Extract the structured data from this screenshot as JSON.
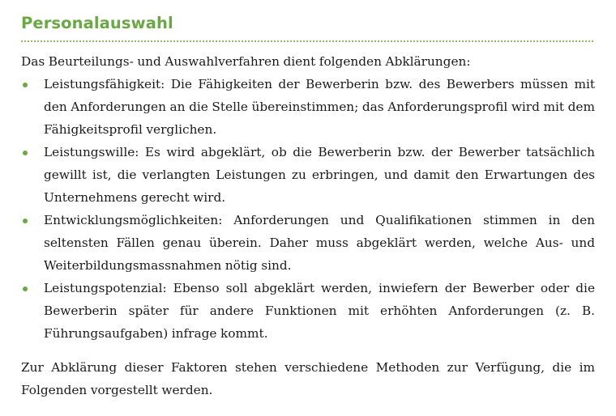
{
  "section": {
    "title": "Personalauswahl",
    "accent_color": "#6aa844"
  },
  "intro": "Das Beurteilungs- und Auswahlverfahren dient folgenden Abklärungen:",
  "items": [
    {
      "text": "Leistungsfähigkeit: Die Fähigkeiten der Bewerberin bzw. des Bewerbers müssen mit den Anforderungen an die Stelle übereinstimmen; das Anforderungsprofil wird mit dem Fähigkeitsprofil verglichen."
    },
    {
      "text": "Leistungswille: Es wird abgeklärt, ob die Bewerberin bzw. der Bewerber tatsäch­lich gewillt ist, die verlangten Leistungen zu erbringen, und damit den Erwartun­gen des Unternehmens gerecht wird."
    },
    {
      "text": "Entwicklungsmöglichkeiten: Anforderungen und Qualifikationen stimmen in den seltensten Fällen genau überein. Daher muss abgeklärt werden, welche Aus- und Weiterbildungsmassnahmen nötig sind."
    },
    {
      "text": "Leistungspotenzial: Ebenso soll abgeklärt werden, inwiefern der Bewerber oder die Bewerberin später für andere Funktionen mit erhöhten Anforderungen (z. B. Führungsaufgaben) infrage kommt."
    }
  ],
  "outro": "Zur Abklärung dieser Faktoren stehen verschiedene Methoden zur Verfügung, die im Folgenden vorgestellt werden."
}
